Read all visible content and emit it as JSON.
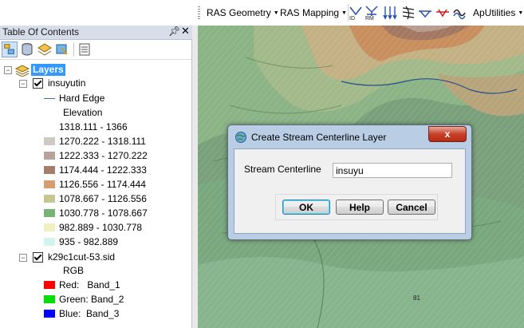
{
  "toolbar": {
    "ras_geometry": "RAS Geometry",
    "ras_mapping": "RAS Mapping",
    "aputilities": "ApUtilities"
  },
  "toc": {
    "title": "Table Of Contents",
    "root_label": "Layers",
    "layer1": {
      "name": "insuyutin",
      "hard_edge": "Hard Edge",
      "elevation_heading": "Elevation",
      "classes": [
        {
          "label": "1318.111 - 1366",
          "color": "#ffffff"
        },
        {
          "label": "1270.222 - 1318.111",
          "color": "#cfc9c4"
        },
        {
          "label": "1222.333 - 1270.222",
          "color": "#b8a29a"
        },
        {
          "label": "1174.444 - 1222.333",
          "color": "#a57f6b"
        },
        {
          "label": "1126.556 - 1174.444",
          "color": "#d89c72"
        },
        {
          "label": "1078.667 - 1126.556",
          "color": "#c6c790"
        },
        {
          "label": "1030.778 - 1078.667",
          "color": "#79b477"
        },
        {
          "label": "982.889 - 1030.778",
          "color": "#f3f0c0"
        },
        {
          "label": "935 - 982.889",
          "color": "#d3f3ef"
        }
      ]
    },
    "layer2": {
      "name": "k29c1cut-53.sid",
      "rgb_heading": "RGB",
      "bands": [
        {
          "label": "Red:   Band_1",
          "color": "#ff0000"
        },
        {
          "label": "Green: Band_2",
          "color": "#00e000"
        },
        {
          "label": "Blue:  Band_3",
          "color": "#0000ff"
        }
      ]
    }
  },
  "dialog": {
    "title": "Create Stream Centerline Layer",
    "close_label": "x",
    "field_label": "Stream Centerline",
    "field_value": "insuyu",
    "ok_label": "OK",
    "help_label": "Help",
    "cancel_label": "Cancel"
  },
  "map": {
    "labels": [
      "81"
    ]
  },
  "colors": {
    "accent": "#b9cde5",
    "close_red": "#c7412b"
  }
}
